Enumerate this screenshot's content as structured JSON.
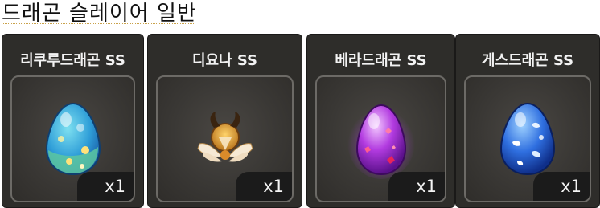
{
  "page_title": "드래곤 슬레이어 일반",
  "items": [
    {
      "name": "리쿠루드래곤 SS",
      "quantity": "x1",
      "icon": "egg-icon-blue-yellow"
    },
    {
      "name": "디요나 SS",
      "quantity": "x1",
      "icon": "horned-winged-emblem-icon"
    },
    {
      "name": "베라드래곤 SS",
      "quantity": "x1",
      "icon": "egg-icon-purple-pink"
    },
    {
      "name": "게스드래곤 SS",
      "quantity": "x1",
      "icon": "egg-icon-blue-white"
    }
  ]
}
